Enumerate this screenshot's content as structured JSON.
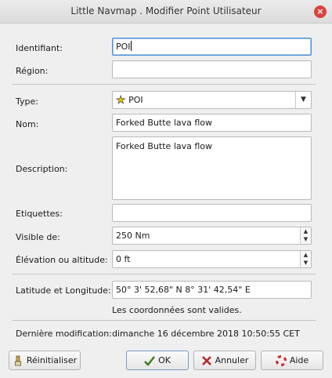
{
  "window": {
    "title": "Little Navmap . Modifier Point Utilisateur",
    "close": "×"
  },
  "form": {
    "ident_label": "Identifiant:",
    "ident_value": "POI",
    "region_label": "Région:",
    "region_value": "",
    "type_label": "Type:",
    "type_value": "POI",
    "name_label": "Nom:",
    "name_value": "Forked Butte lava flow",
    "description_label": "Description:",
    "description_value": "Forked Butte lava flow",
    "tags_label": "Etiquettes:",
    "tags_value": "",
    "visible_label": "Visible de:",
    "visible_value": "250 Nm",
    "elevation_label": "Élévation ou altitude:",
    "elevation_value": "0 ft",
    "latlon_label": "Latitude et Longitude:",
    "latlon_value": "50° 3' 52,68\" N 8° 31' 42,54\" E",
    "coords_status": "Les coordonnées sont valides.",
    "lastmod_label": "Dernière modification:",
    "lastmod_value": "dimanche 16 décembre 2018 10:50:55 CET"
  },
  "buttons": {
    "reset": "Réinitialiser",
    "ok": "OK",
    "cancel": "Annuler",
    "help": "Aide"
  },
  "icons": {
    "combo_arrow": "▼",
    "spin_up": "▲",
    "spin_down": "▼",
    "star": "★"
  }
}
